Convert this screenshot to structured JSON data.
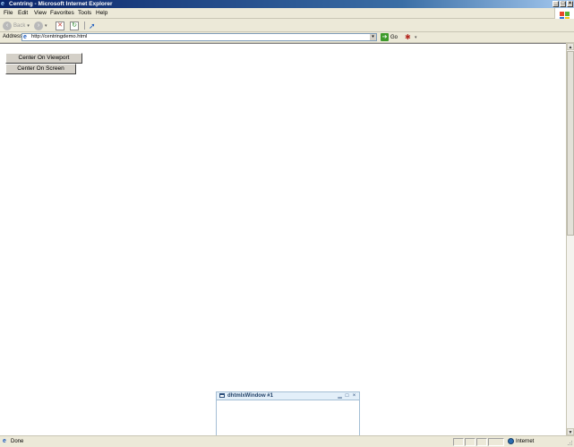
{
  "window": {
    "title": "Centring - Microsoft Internet Explorer",
    "controls": {
      "minimize": "_",
      "maximize": "□",
      "close": "×"
    }
  },
  "menu": {
    "items": [
      {
        "label": "File"
      },
      {
        "label": "Edit"
      },
      {
        "label": "View"
      },
      {
        "label": "Favorites"
      },
      {
        "label": "Tools"
      },
      {
        "label": "Help"
      }
    ]
  },
  "toolbar": {
    "back_label": "Back",
    "back_icon": "back-arrow-icon",
    "forward_icon": "forward-arrow-icon",
    "stop_icon": "stop-icon",
    "refresh_icon": "refresh-icon",
    "select_icon": "cursor-icon",
    "dropdown_glyph": "▾"
  },
  "address": {
    "label": "Address",
    "url": "http://centringdemo.html",
    "go_label": "Go"
  },
  "content": {
    "buttons": [
      {
        "label": "Center On Viewport"
      },
      {
        "label": "Center On Screen"
      }
    ]
  },
  "dhx_window": {
    "title": "dhtmlxWindow #1",
    "min_glyph": "▁",
    "max_glyph": "□",
    "close_glyph": "×"
  },
  "status": {
    "text": "Done",
    "zone": "Internet"
  },
  "colors": {
    "titlebar_start": "#0a246a",
    "chrome_bg": "#ece9d8",
    "button_face": "#d4d0c8",
    "dhx_header": "#e3eff9",
    "dhx_border": "#a4bed4"
  }
}
